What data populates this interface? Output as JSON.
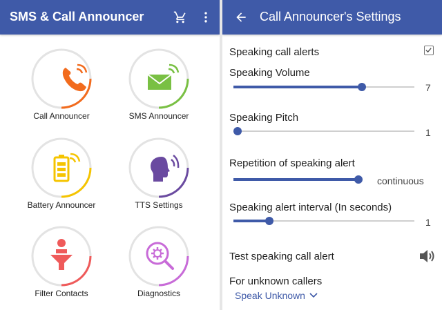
{
  "left": {
    "title": "SMS & Call Announcer",
    "icons": {
      "cart": "cart-icon",
      "menu": "more-vert-icon"
    },
    "tiles": [
      {
        "label": "Call Announcer",
        "icon": "phone-icon",
        "ring_color": "#f26b1d",
        "icon_color": "#f26b1d"
      },
      {
        "label": "SMS Announcer",
        "icon": "envelope-icon",
        "ring_color": "#79c043",
        "icon_color": "#79c043"
      },
      {
        "label": "Battery Announcer",
        "icon": "battery-icon",
        "ring_color": "#f5c400",
        "icon_color": "#f5c400"
      },
      {
        "label": "TTS Settings",
        "icon": "speaking-head-icon",
        "ring_color": "#6a4aa0",
        "icon_color": "#6a4aa0"
      },
      {
        "label": "Filter Contacts",
        "icon": "filter-icon",
        "ring_color": "#ef5a5a",
        "icon_color": "#ef5a5a"
      },
      {
        "label": "Diagnostics",
        "icon": "gear-search-icon",
        "ring_color": "#c86bd8",
        "icon_color": "#c86bd8"
      }
    ]
  },
  "right": {
    "title": "Call Announcer's Settings",
    "back_icon": "back-arrow-icon",
    "speaking_call_alerts": {
      "label": "Speaking call alerts",
      "checked": true
    },
    "speaking_volume": {
      "label": "Speaking Volume",
      "value": "7",
      "fraction": 0.71
    },
    "speaking_pitch": {
      "label": "Speaking Pitch",
      "value": "1",
      "fraction": 0.0
    },
    "repetition": {
      "label": "Repetition of speaking alert",
      "value": "continuous",
      "fraction": 1.0
    },
    "interval": {
      "label": "Speaking alert interval (In seconds)",
      "value": "1",
      "fraction": 0.2
    },
    "test_alert": {
      "label": "Test speaking call alert",
      "icon": "speaker-icon"
    },
    "unknown_callers": {
      "label": "For unknown callers",
      "selected": "Speak Unknown",
      "icon": "chevron-down-icon"
    }
  },
  "colors": {
    "appbar": "#3f5aa8",
    "accent": "#3f5aa8"
  }
}
